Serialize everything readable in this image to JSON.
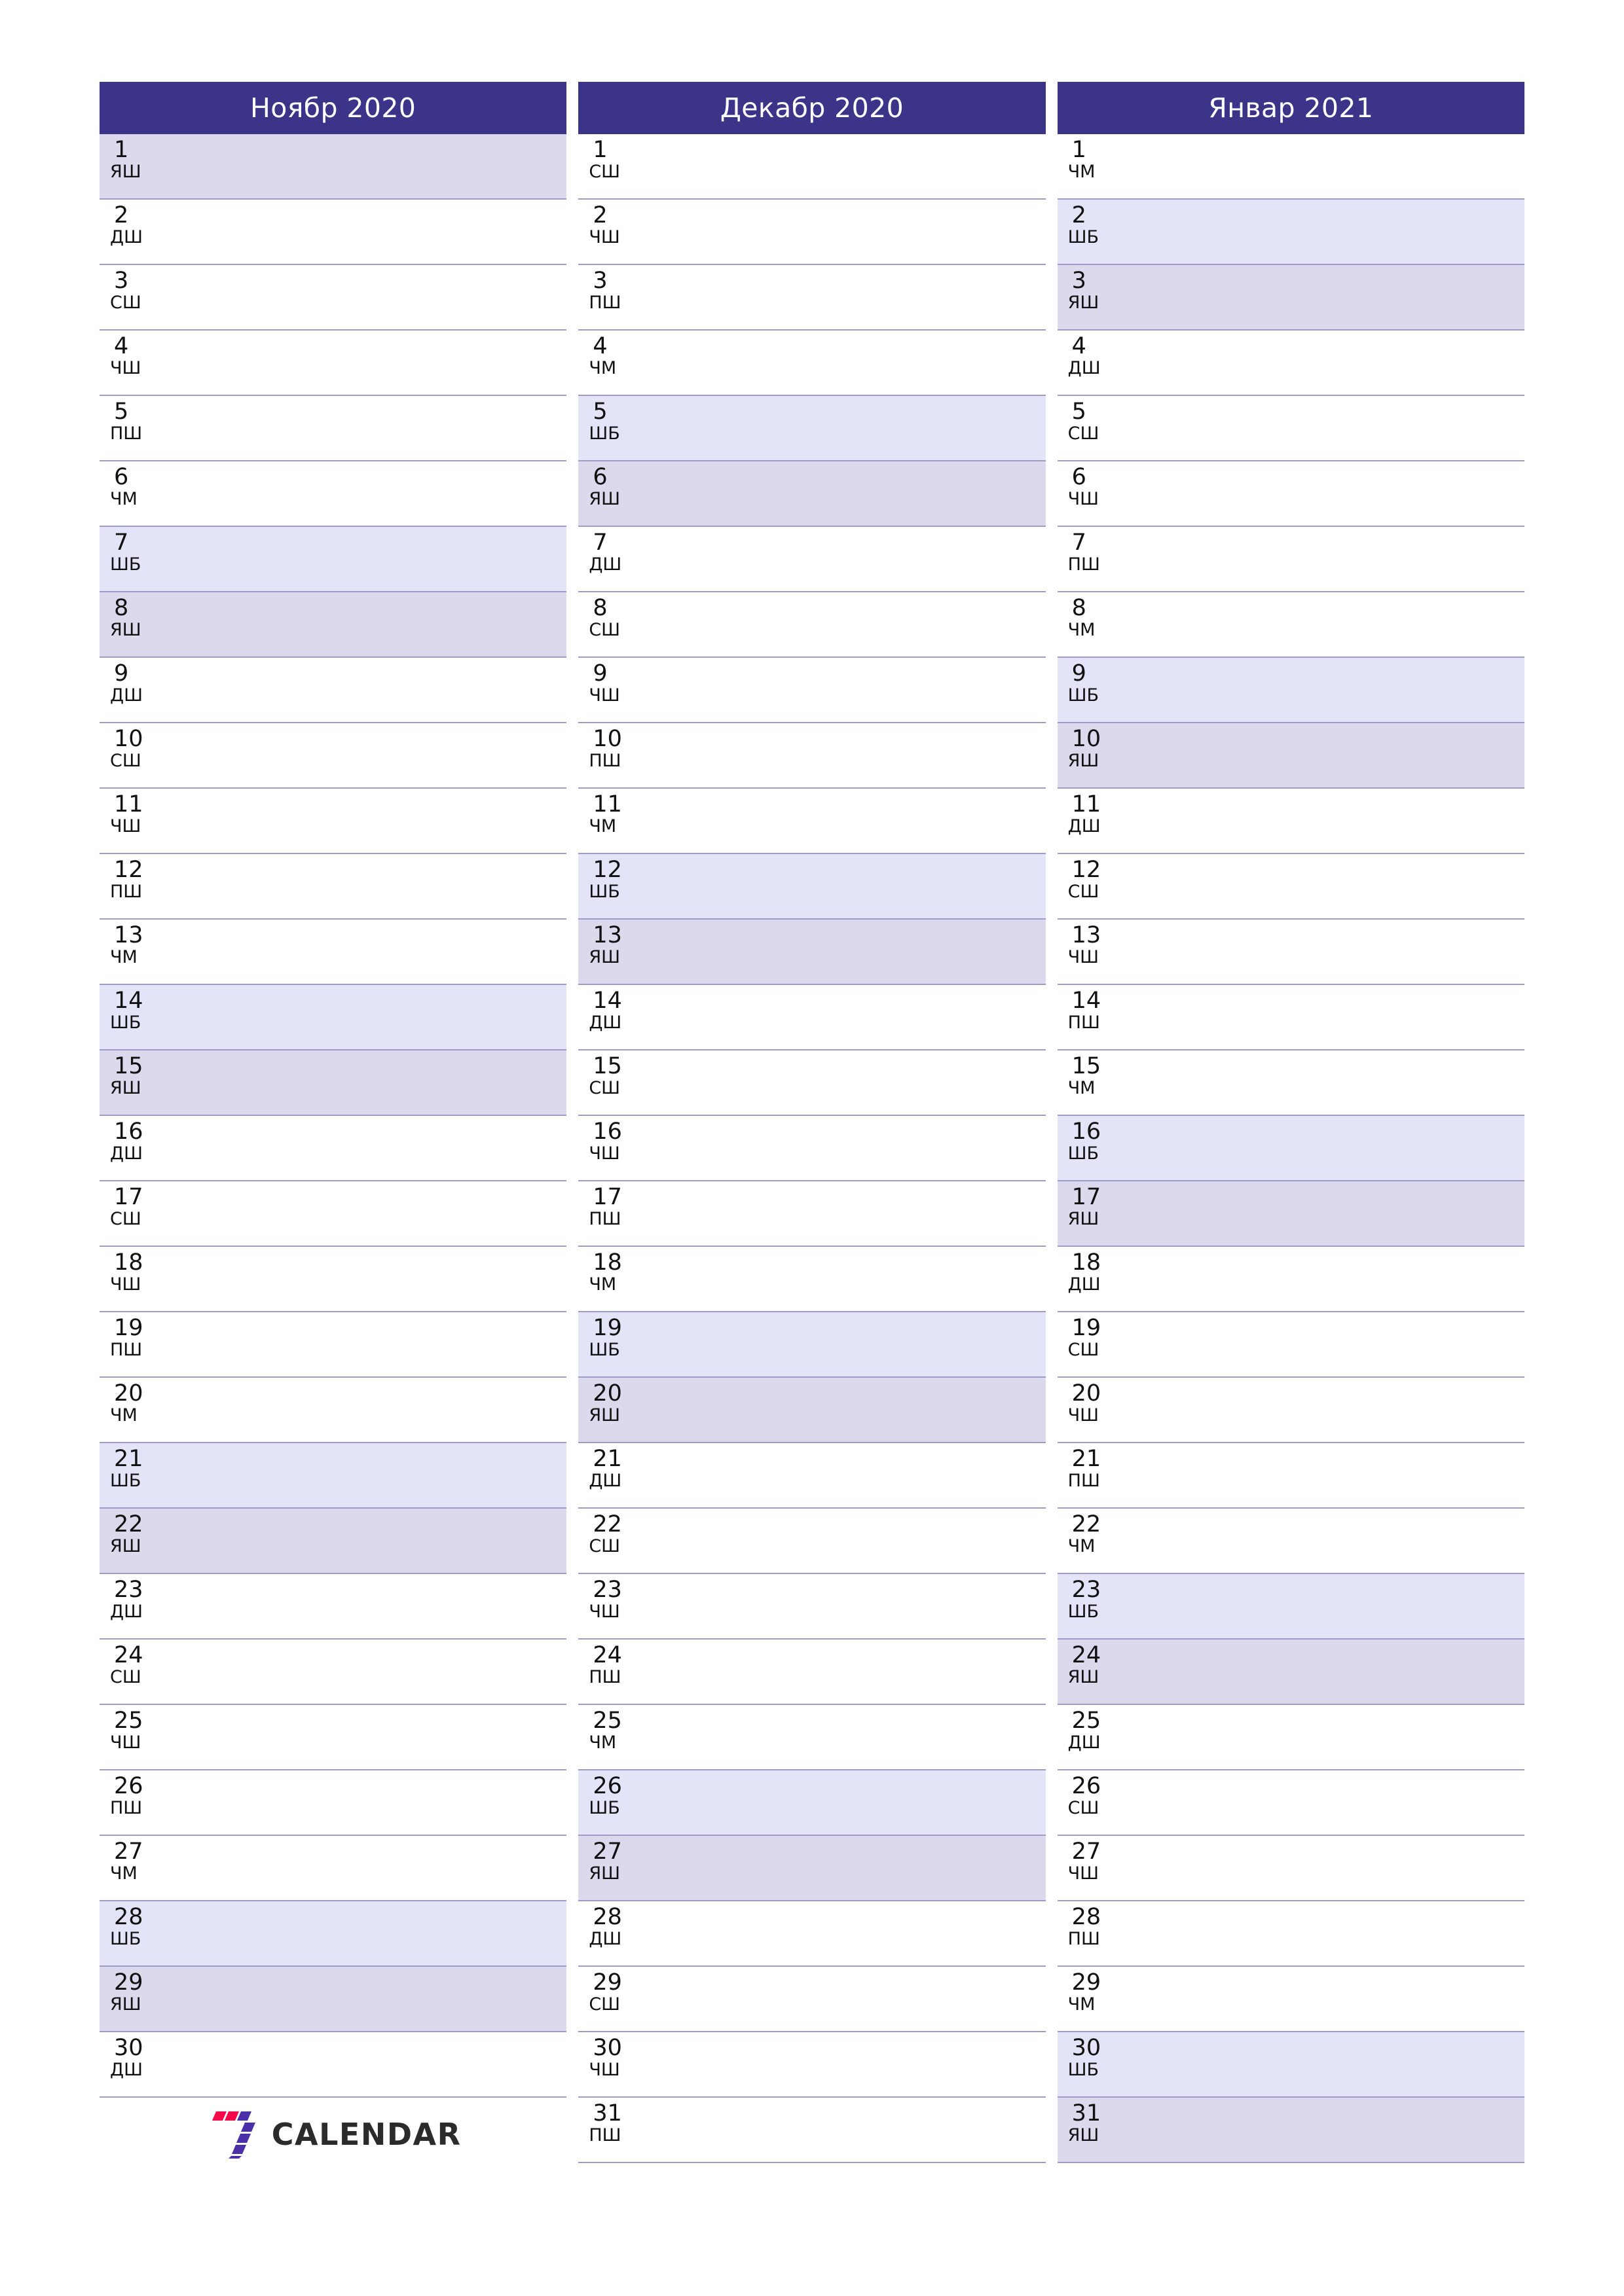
{
  "document": {
    "kind": "monthly-planner",
    "orientation": "portrait"
  },
  "theme": {
    "header_bg": "#3b3488",
    "header_text": "#ffffff",
    "saturday_bg": "#e3e4f7",
    "sunday_bg": "#ddd9ec",
    "row_border": "#9d9bc8",
    "day_text": "#111111",
    "logo_red": "#f5094a",
    "logo_purple": "#4b2fa8",
    "logo_text": "#2b2b2b"
  },
  "brand": {
    "mark_name": "seven-logo-icon",
    "text": "CALENDAR"
  },
  "months": [
    {
      "title": "Ноябр 2020",
      "days": [
        {
          "num": "1",
          "wd": "ЯШ",
          "type": "sun"
        },
        {
          "num": "2",
          "wd": "ДШ",
          "type": "wd"
        },
        {
          "num": "3",
          "wd": "СШ",
          "type": "wd"
        },
        {
          "num": "4",
          "wd": "ЧШ",
          "type": "wd"
        },
        {
          "num": "5",
          "wd": "ПШ",
          "type": "wd"
        },
        {
          "num": "6",
          "wd": "ЧМ",
          "type": "wd"
        },
        {
          "num": "7",
          "wd": "ШБ",
          "type": "sat"
        },
        {
          "num": "8",
          "wd": "ЯШ",
          "type": "sun"
        },
        {
          "num": "9",
          "wd": "ДШ",
          "type": "wd"
        },
        {
          "num": "10",
          "wd": "СШ",
          "type": "wd"
        },
        {
          "num": "11",
          "wd": "ЧШ",
          "type": "wd"
        },
        {
          "num": "12",
          "wd": "ПШ",
          "type": "wd"
        },
        {
          "num": "13",
          "wd": "ЧМ",
          "type": "wd"
        },
        {
          "num": "14",
          "wd": "ШБ",
          "type": "sat"
        },
        {
          "num": "15",
          "wd": "ЯШ",
          "type": "sun"
        },
        {
          "num": "16",
          "wd": "ДШ",
          "type": "wd"
        },
        {
          "num": "17",
          "wd": "СШ",
          "type": "wd"
        },
        {
          "num": "18",
          "wd": "ЧШ",
          "type": "wd"
        },
        {
          "num": "19",
          "wd": "ПШ",
          "type": "wd"
        },
        {
          "num": "20",
          "wd": "ЧМ",
          "type": "wd"
        },
        {
          "num": "21",
          "wd": "ШБ",
          "type": "sat"
        },
        {
          "num": "22",
          "wd": "ЯШ",
          "type": "sun"
        },
        {
          "num": "23",
          "wd": "ДШ",
          "type": "wd"
        },
        {
          "num": "24",
          "wd": "СШ",
          "type": "wd"
        },
        {
          "num": "25",
          "wd": "ЧШ",
          "type": "wd"
        },
        {
          "num": "26",
          "wd": "ПШ",
          "type": "wd"
        },
        {
          "num": "27",
          "wd": "ЧМ",
          "type": "wd"
        },
        {
          "num": "28",
          "wd": "ШБ",
          "type": "sat"
        },
        {
          "num": "29",
          "wd": "ЯШ",
          "type": "sun"
        },
        {
          "num": "30",
          "wd": "ДШ",
          "type": "wd"
        }
      ]
    },
    {
      "title": "Декабр 2020",
      "days": [
        {
          "num": "1",
          "wd": "СШ",
          "type": "wd"
        },
        {
          "num": "2",
          "wd": "ЧШ",
          "type": "wd"
        },
        {
          "num": "3",
          "wd": "ПШ",
          "type": "wd"
        },
        {
          "num": "4",
          "wd": "ЧМ",
          "type": "wd"
        },
        {
          "num": "5",
          "wd": "ШБ",
          "type": "sat"
        },
        {
          "num": "6",
          "wd": "ЯШ",
          "type": "sun"
        },
        {
          "num": "7",
          "wd": "ДШ",
          "type": "wd"
        },
        {
          "num": "8",
          "wd": "СШ",
          "type": "wd"
        },
        {
          "num": "9",
          "wd": "ЧШ",
          "type": "wd"
        },
        {
          "num": "10",
          "wd": "ПШ",
          "type": "wd"
        },
        {
          "num": "11",
          "wd": "ЧМ",
          "type": "wd"
        },
        {
          "num": "12",
          "wd": "ШБ",
          "type": "sat"
        },
        {
          "num": "13",
          "wd": "ЯШ",
          "type": "sun"
        },
        {
          "num": "14",
          "wd": "ДШ",
          "type": "wd"
        },
        {
          "num": "15",
          "wd": "СШ",
          "type": "wd"
        },
        {
          "num": "16",
          "wd": "ЧШ",
          "type": "wd"
        },
        {
          "num": "17",
          "wd": "ПШ",
          "type": "wd"
        },
        {
          "num": "18",
          "wd": "ЧМ",
          "type": "wd"
        },
        {
          "num": "19",
          "wd": "ШБ",
          "type": "sat"
        },
        {
          "num": "20",
          "wd": "ЯШ",
          "type": "sun"
        },
        {
          "num": "21",
          "wd": "ДШ",
          "type": "wd"
        },
        {
          "num": "22",
          "wd": "СШ",
          "type": "wd"
        },
        {
          "num": "23",
          "wd": "ЧШ",
          "type": "wd"
        },
        {
          "num": "24",
          "wd": "ПШ",
          "type": "wd"
        },
        {
          "num": "25",
          "wd": "ЧМ",
          "type": "wd"
        },
        {
          "num": "26",
          "wd": "ШБ",
          "type": "sat"
        },
        {
          "num": "27",
          "wd": "ЯШ",
          "type": "sun"
        },
        {
          "num": "28",
          "wd": "ДШ",
          "type": "wd"
        },
        {
          "num": "29",
          "wd": "СШ",
          "type": "wd"
        },
        {
          "num": "30",
          "wd": "ЧШ",
          "type": "wd"
        },
        {
          "num": "31",
          "wd": "ПШ",
          "type": "wd"
        }
      ]
    },
    {
      "title": "Январ 2021",
      "days": [
        {
          "num": "1",
          "wd": "ЧМ",
          "type": "wd"
        },
        {
          "num": "2",
          "wd": "ШБ",
          "type": "sat"
        },
        {
          "num": "3",
          "wd": "ЯШ",
          "type": "sun"
        },
        {
          "num": "4",
          "wd": "ДШ",
          "type": "wd"
        },
        {
          "num": "5",
          "wd": "СШ",
          "type": "wd"
        },
        {
          "num": "6",
          "wd": "ЧШ",
          "type": "wd"
        },
        {
          "num": "7",
          "wd": "ПШ",
          "type": "wd"
        },
        {
          "num": "8",
          "wd": "ЧМ",
          "type": "wd"
        },
        {
          "num": "9",
          "wd": "ШБ",
          "type": "sat"
        },
        {
          "num": "10",
          "wd": "ЯШ",
          "type": "sun"
        },
        {
          "num": "11",
          "wd": "ДШ",
          "type": "wd"
        },
        {
          "num": "12",
          "wd": "СШ",
          "type": "wd"
        },
        {
          "num": "13",
          "wd": "ЧШ",
          "type": "wd"
        },
        {
          "num": "14",
          "wd": "ПШ",
          "type": "wd"
        },
        {
          "num": "15",
          "wd": "ЧМ",
          "type": "wd"
        },
        {
          "num": "16",
          "wd": "ШБ",
          "type": "sat"
        },
        {
          "num": "17",
          "wd": "ЯШ",
          "type": "sun"
        },
        {
          "num": "18",
          "wd": "ДШ",
          "type": "wd"
        },
        {
          "num": "19",
          "wd": "СШ",
          "type": "wd"
        },
        {
          "num": "20",
          "wd": "ЧШ",
          "type": "wd"
        },
        {
          "num": "21",
          "wd": "ПШ",
          "type": "wd"
        },
        {
          "num": "22",
          "wd": "ЧМ",
          "type": "wd"
        },
        {
          "num": "23",
          "wd": "ШБ",
          "type": "sat"
        },
        {
          "num": "24",
          "wd": "ЯШ",
          "type": "sun"
        },
        {
          "num": "25",
          "wd": "ДШ",
          "type": "wd"
        },
        {
          "num": "26",
          "wd": "СШ",
          "type": "wd"
        },
        {
          "num": "27",
          "wd": "ЧШ",
          "type": "wd"
        },
        {
          "num": "28",
          "wd": "ПШ",
          "type": "wd"
        },
        {
          "num": "29",
          "wd": "ЧМ",
          "type": "wd"
        },
        {
          "num": "30",
          "wd": "ШБ",
          "type": "sat"
        },
        {
          "num": "31",
          "wd": "ЯШ",
          "type": "sun"
        }
      ]
    }
  ]
}
